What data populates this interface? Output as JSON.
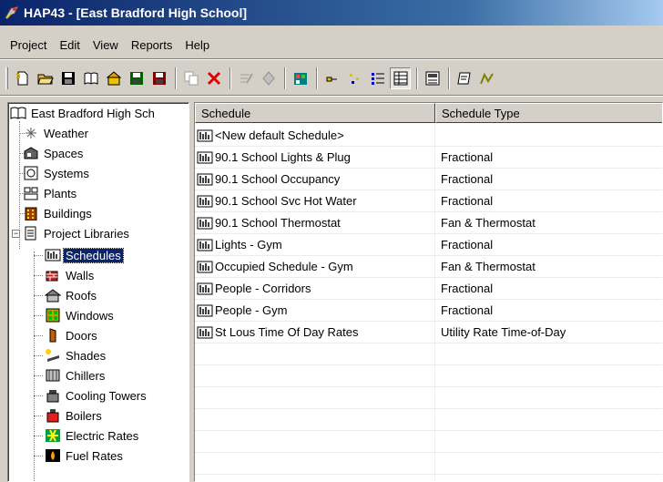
{
  "window": {
    "title": "HAP43 - [East Bradford High School]",
    "app_icon": "hap-app-icon"
  },
  "menu": [
    "Project",
    "Edit",
    "View",
    "Reports",
    "Help"
  ],
  "toolbar": {
    "buttons": [
      "new-project-icon",
      "open-folder-icon",
      "save-icon",
      "library-book-icon",
      "archive-icon",
      "save-as-icon",
      "floppy-red-icon",
      "copy-icon",
      "delete-icon",
      "edit-disabled-icon",
      "diamond-disabled-icon",
      "building-wizard-icon",
      "large-icons-icon",
      "small-icons-icon",
      "list-view-icon",
      "details-view-icon",
      "calculator-icon",
      "report-icon",
      "chart-icon"
    ]
  },
  "tree": {
    "root": "East Bradford High Sch",
    "items": [
      {
        "label": "Weather",
        "icon": "weather-icon"
      },
      {
        "label": "Spaces",
        "icon": "spaces-icon"
      },
      {
        "label": "Systems",
        "icon": "systems-icon"
      },
      {
        "label": "Plants",
        "icon": "plants-icon"
      },
      {
        "label": "Buildings",
        "icon": "buildings-icon"
      },
      {
        "label": "Project Libraries",
        "icon": "library-icon"
      }
    ],
    "libraries": [
      {
        "label": "Schedules",
        "icon": "schedules-icon",
        "selected": true
      },
      {
        "label": "Walls",
        "icon": "walls-icon"
      },
      {
        "label": "Roofs",
        "icon": "roofs-icon"
      },
      {
        "label": "Windows",
        "icon": "windows-icon"
      },
      {
        "label": "Doors",
        "icon": "doors-icon"
      },
      {
        "label": "Shades",
        "icon": "shades-icon"
      },
      {
        "label": "Chillers",
        "icon": "chillers-icon"
      },
      {
        "label": "Cooling Towers",
        "icon": "cooling-towers-icon"
      },
      {
        "label": "Boilers",
        "icon": "boilers-icon"
      },
      {
        "label": "Electric Rates",
        "icon": "electric-rates-icon"
      },
      {
        "label": "Fuel Rates",
        "icon": "fuel-rates-icon"
      }
    ]
  },
  "list": {
    "columns": [
      "Schedule",
      "Schedule Type"
    ],
    "rows": [
      {
        "name": "<New default Schedule>",
        "type": ""
      },
      {
        "name": "90.1 School Lights & Plug",
        "type": "Fractional"
      },
      {
        "name": "90.1 School Occupancy",
        "type": "Fractional"
      },
      {
        "name": "90.1 School Svc Hot Water",
        "type": "Fractional"
      },
      {
        "name": "90.1 School Thermostat",
        "type": "Fan & Thermostat"
      },
      {
        "name": "Lights - Gym",
        "type": "Fractional"
      },
      {
        "name": "Occupied Schedule - Gym",
        "type": "Fan & Thermostat"
      },
      {
        "name": "People - Corridors",
        "type": "Fractional"
      },
      {
        "name": "People - Gym",
        "type": "Fractional"
      },
      {
        "name": "St Lous Time Of Day Rates",
        "type": "Utility Rate Time-of-Day"
      }
    ]
  }
}
